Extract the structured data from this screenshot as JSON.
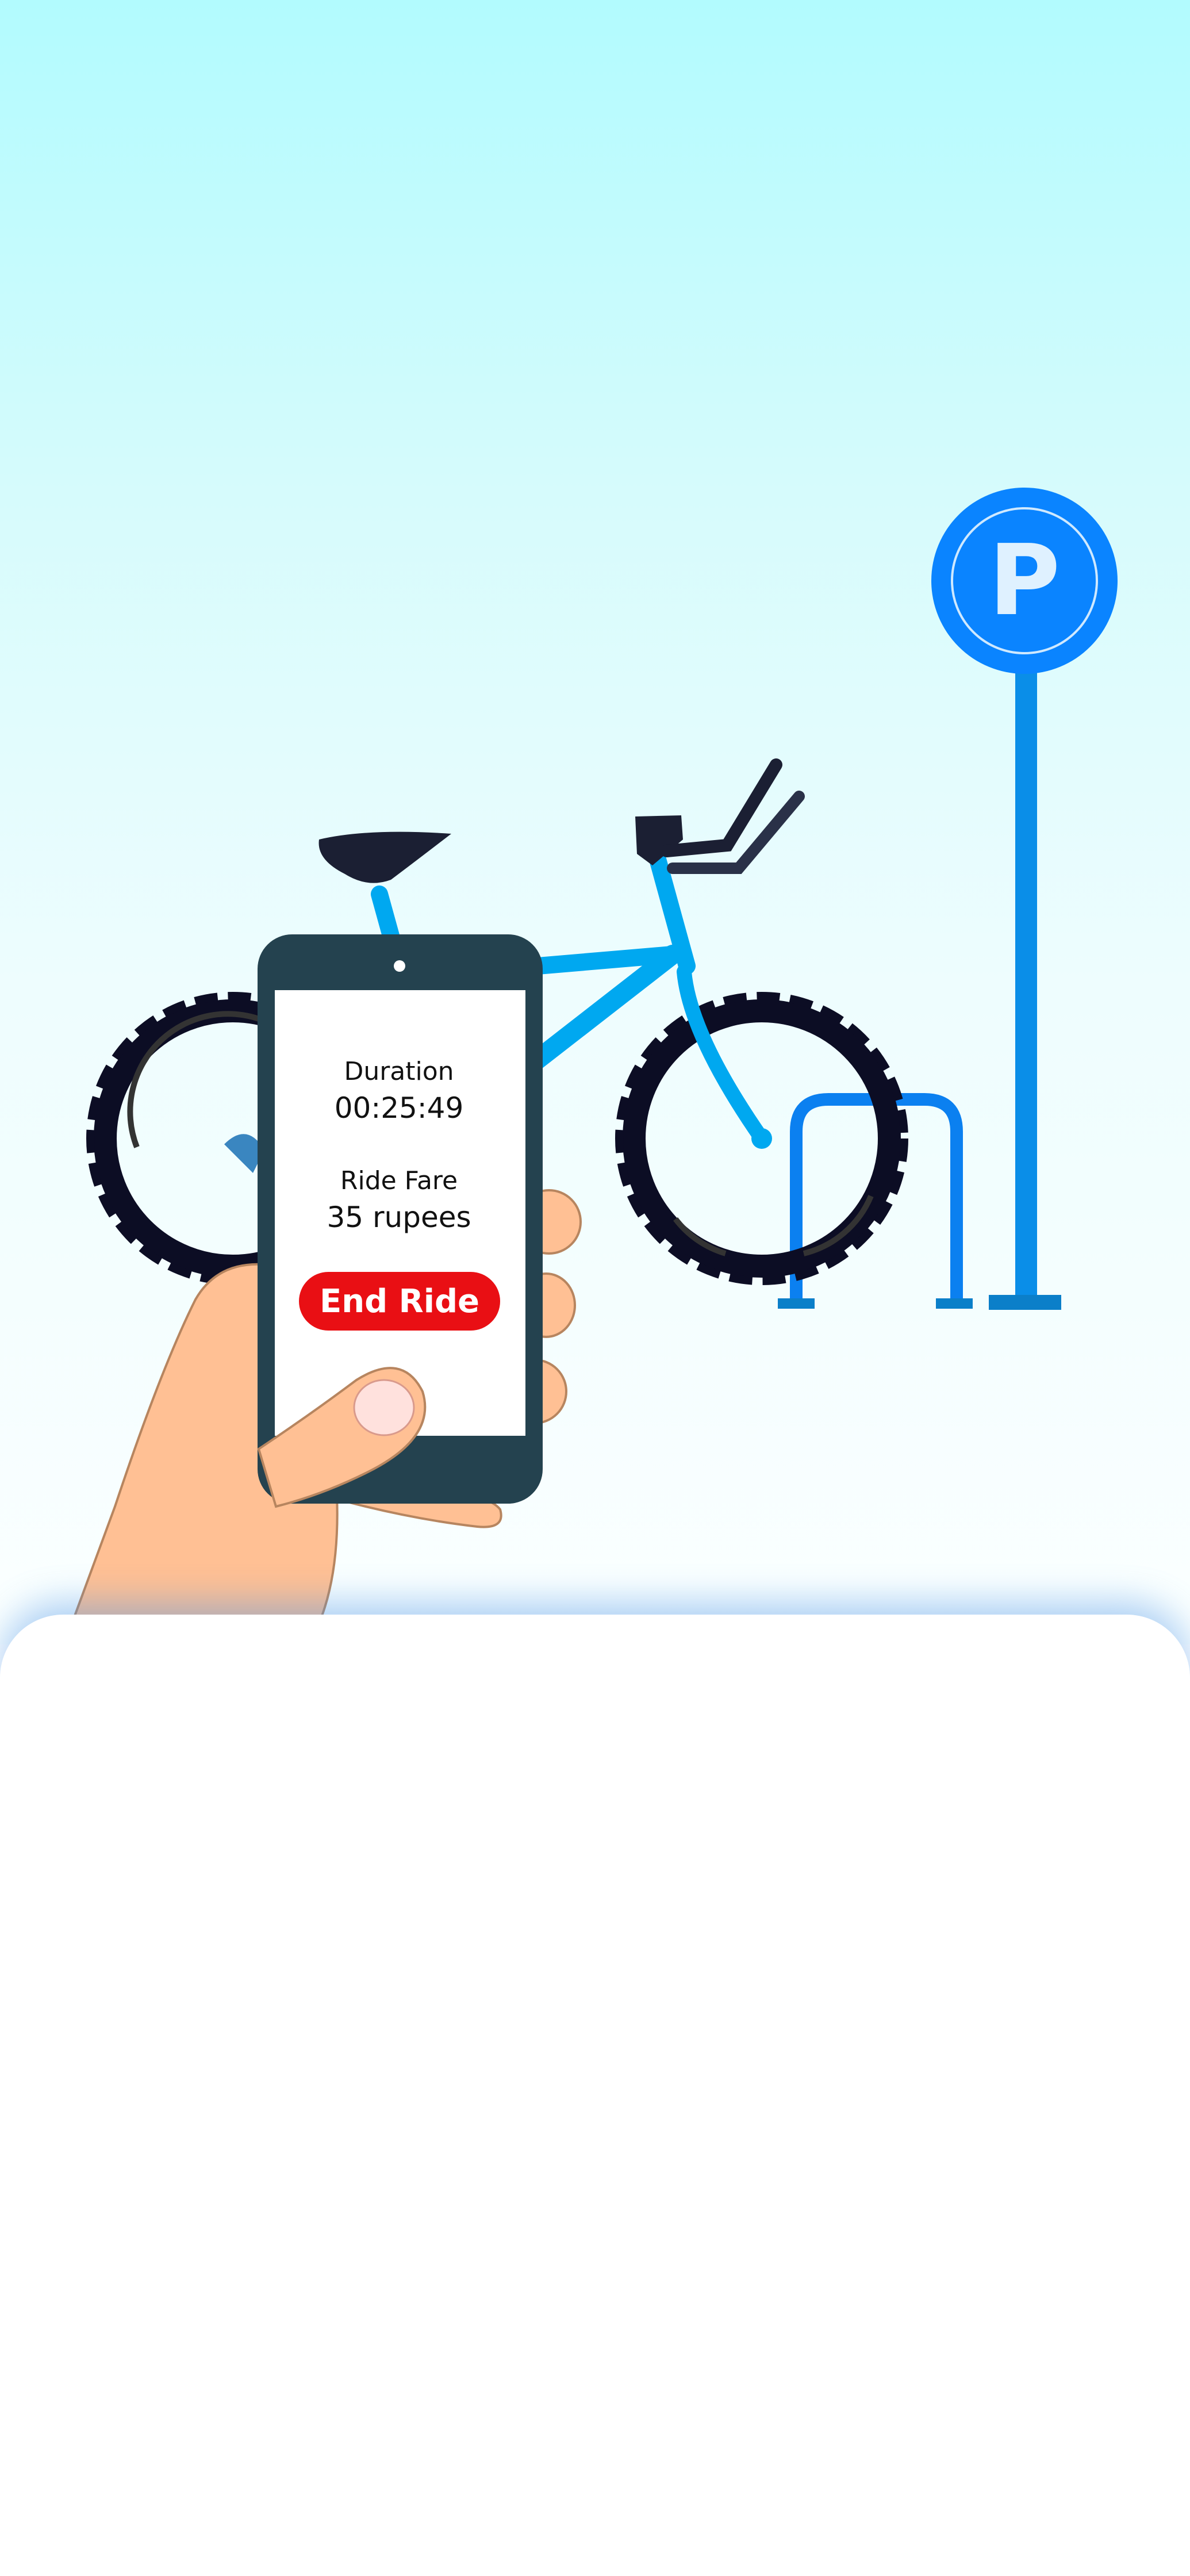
{
  "ride": {
    "duration_label": "Duration",
    "duration_value": "00:25:49",
    "fare_label": "Ride Fare",
    "fare_value": "35 rupees"
  },
  "actions": {
    "end_ride_label": "End Ride"
  },
  "parking_sign": {
    "letter": "P"
  },
  "icons": {
    "parking": "parking-sign-icon",
    "bike": "bicycle-illustration",
    "hand": "hand-holding-phone",
    "rack": "bike-rack"
  },
  "colors": {
    "accent_red": "#e90f14",
    "bike_blue": "#00a8f0",
    "sign_blue": "#0a84ff",
    "phone_body": "#24424f"
  }
}
